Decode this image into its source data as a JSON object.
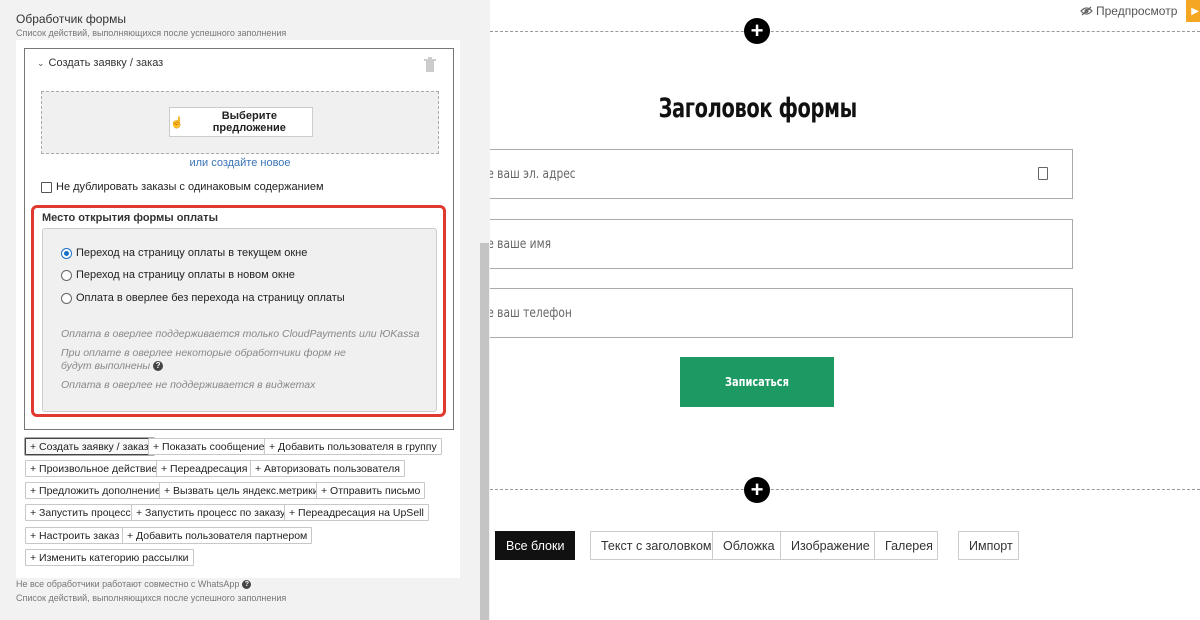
{
  "left": {
    "section_title": "Обработчик формы",
    "section_subtitle": "Список действий, выполняющихся после успешного заполнения",
    "order": {
      "title": "Создать заявку / заказ",
      "offer_button": "Выберите предложение",
      "create_new_link": "или создайте новое",
      "dup_checkbox_label": "Не дублировать заказы с одинаковым содержанием",
      "dup_checked": false
    },
    "payment": {
      "title": "Место открытия формы оплаты",
      "options": [
        {
          "label": "Переход на страницу оплаты в текущем окне",
          "selected": true
        },
        {
          "label": "Переход на страницу оплаты в новом окне",
          "selected": false
        },
        {
          "label": "Оплата в оверлее без перехода на страницу оплаты",
          "selected": false
        }
      ],
      "notes": [
        "Оплата в оверлее поддерживается только CloudPayments или ЮKassa",
        "При оплате в оверлее некоторые обработчики форм не будут выполнены",
        "Оплата в оверлее не поддерживается в виджетах"
      ]
    },
    "actions": [
      "+ Создать заявку / заказ",
      "+ Показать сообщение",
      "+ Добавить пользователя в группу",
      "+ Произвольное действие",
      "+ Переадресация",
      "+ Авторизовать пользователя",
      "+ Предложить дополнение",
      "+ Вызвать цель яндекс.метрики",
      "+ Отправить письмо",
      "+ Запустить процесс",
      "+ Запустить процесс по заказу",
      "+ Переадресация на UpSell",
      "+ Настроить заказ",
      "+ Добавить пользователя партнером",
      "+ Изменить категорию рассылки"
    ],
    "footer_note": "Не все обработчики работают совместно с WhatsApp",
    "footer_subtitle": "Список действий, выполняющихся после успешного заполнения"
  },
  "right": {
    "preview_label": "Предпросмотр",
    "form_title": "Заголовок формы",
    "fields": [
      {
        "placeholder": "те ваш эл. адрес"
      },
      {
        "placeholder": "те ваше имя"
      },
      {
        "placeholder": "те ваш телефон"
      }
    ],
    "submit_label": "Записаться",
    "submit_color": "#1d9a63",
    "block_buttons": [
      "Все блоки",
      "Текст с заголовком",
      "Обложка",
      "Изображение",
      "Галерея",
      "Импорт"
    ]
  },
  "colors": {
    "accent_red": "#e03a30",
    "link_blue": "#3a74b5",
    "preview_orange": "#f5a623"
  }
}
